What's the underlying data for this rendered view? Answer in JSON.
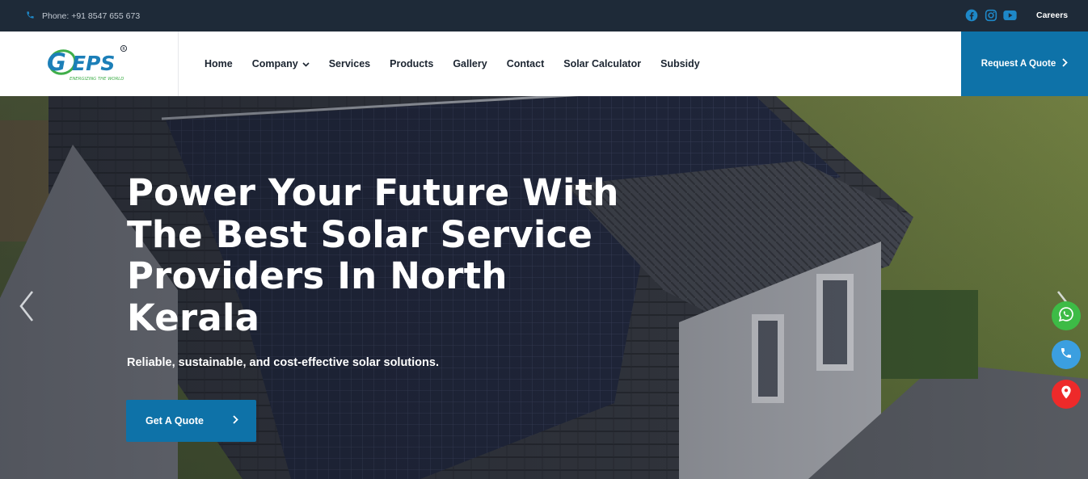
{
  "topbar": {
    "phone_text": "Phone: +91 8547 655 673",
    "careers_label": "Careers",
    "socials": [
      "facebook-icon",
      "instagram-icon",
      "youtube-icon"
    ],
    "social_color": "#1e88c8"
  },
  "header": {
    "logo_text": "GEPS",
    "logo_tagline": "ENERGIZING THE WORLD",
    "logo_registered": "®",
    "nav": [
      {
        "label": "Home"
      },
      {
        "label": "Company",
        "has_dropdown": true
      },
      {
        "label": "Services"
      },
      {
        "label": "Products"
      },
      {
        "label": "Gallery"
      },
      {
        "label": "Contact"
      },
      {
        "label": "Solar Calculator"
      },
      {
        "label": "Subsidy"
      }
    ],
    "quote_button": "Request A Quote"
  },
  "hero": {
    "title": "Power Your Future With The Best Solar Service Providers In North Kerala",
    "subtitle": "Reliable, sustainable, and cost-effective solar solutions.",
    "cta_label": "Get A Quote"
  },
  "colors": {
    "topbar_bg": "#1e2a38",
    "accent": "#0e72a8",
    "whatsapp": "#3dbb46",
    "call": "#3b9fe0",
    "location": "#ee2a2a"
  }
}
